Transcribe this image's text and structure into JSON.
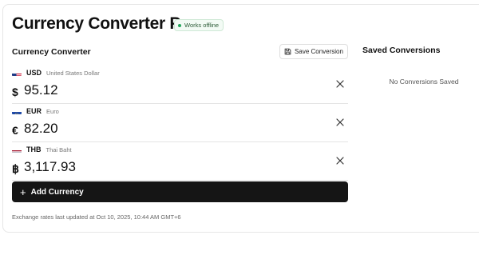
{
  "app": {
    "title": "Currency Converter Pro",
    "badge": "Works offline"
  },
  "converter": {
    "section_title": "Currency Converter",
    "save_label": "Save Conversion",
    "add_label": "Add Currency",
    "rows": [
      {
        "flag": "us-flag",
        "code": "USD",
        "name": "United States Dollar",
        "symbol": "$",
        "amount": "95.12"
      },
      {
        "flag": "eu-flag",
        "code": "EUR",
        "name": "Euro",
        "symbol": "€",
        "amount": "82.20"
      },
      {
        "flag": "th-flag",
        "code": "THB",
        "name": "Thai Baht",
        "symbol": "฿",
        "amount": "3,117.93"
      }
    ],
    "footnote": "Exchange rates last updated at Oct 10, 2025, 10:44 AM GMT+6"
  },
  "saved": {
    "title": "Saved Conversions",
    "empty_text": "No Conversions Saved"
  },
  "colors": {
    "primary_button": "#151515",
    "badge_dot": "#22a65a",
    "border": "#e4e4e4"
  }
}
